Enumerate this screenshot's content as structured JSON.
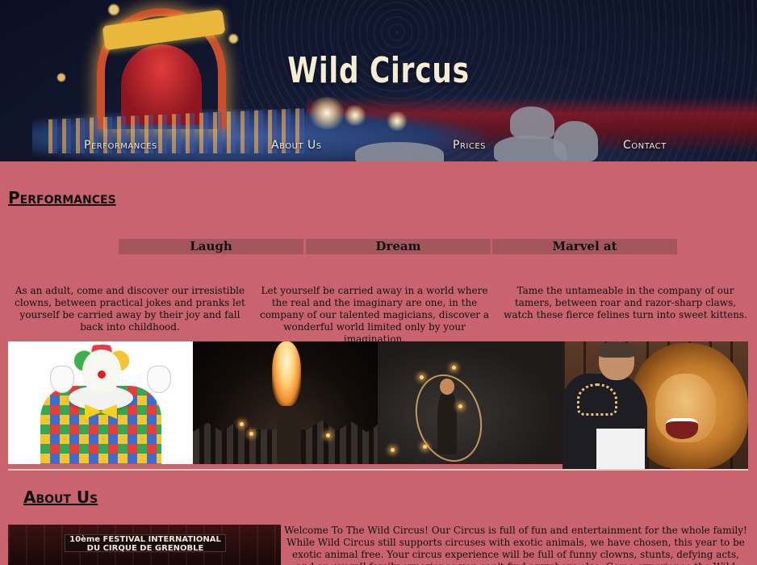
{
  "hero": {
    "title": "Wild Circus",
    "nav": [
      "Performances",
      "About Us",
      "Prices",
      "Contact"
    ]
  },
  "performances": {
    "heading": "Performances",
    "tabs": [
      "Laugh",
      "Dream",
      "Marvel at"
    ],
    "descriptions": [
      "As an adult, come and discover our irresistible clowns, between practical jokes and pranks let yourself be carried away by their joy and fall back into childhood.",
      "Let yourself be carried away in a world where the real and the imaginary are one, in the company of our talented magicians, discover a wonderful world limited only by your imagination.",
      "Tame the untameable in the company of our tamers, between roar and razor-sharp claws, watch these fierce felines turn into sweet kittens."
    ]
  },
  "about": {
    "heading": "About Us",
    "image_banner": "10ème FESTIVAL INTERNATIONAL DU CIRQUE DE GRENOBLE",
    "text": "Welcome To The Wild Circus! Our Circus is full of fun and entertainment for the whole family! While Wild Circus still supports circuses with exotic animals, we have chosen, this year to be exotic animal free. Your circus experience will be full of funny clowns, stunts, defying acts, and an overall family experience you can't find anywhere else. Come experience the Wild Circus, coming to a town near you!"
  },
  "colors": {
    "page_background": "#c9636d",
    "tab_background": "#a3565c",
    "hero_text": "#f5ecd6"
  }
}
